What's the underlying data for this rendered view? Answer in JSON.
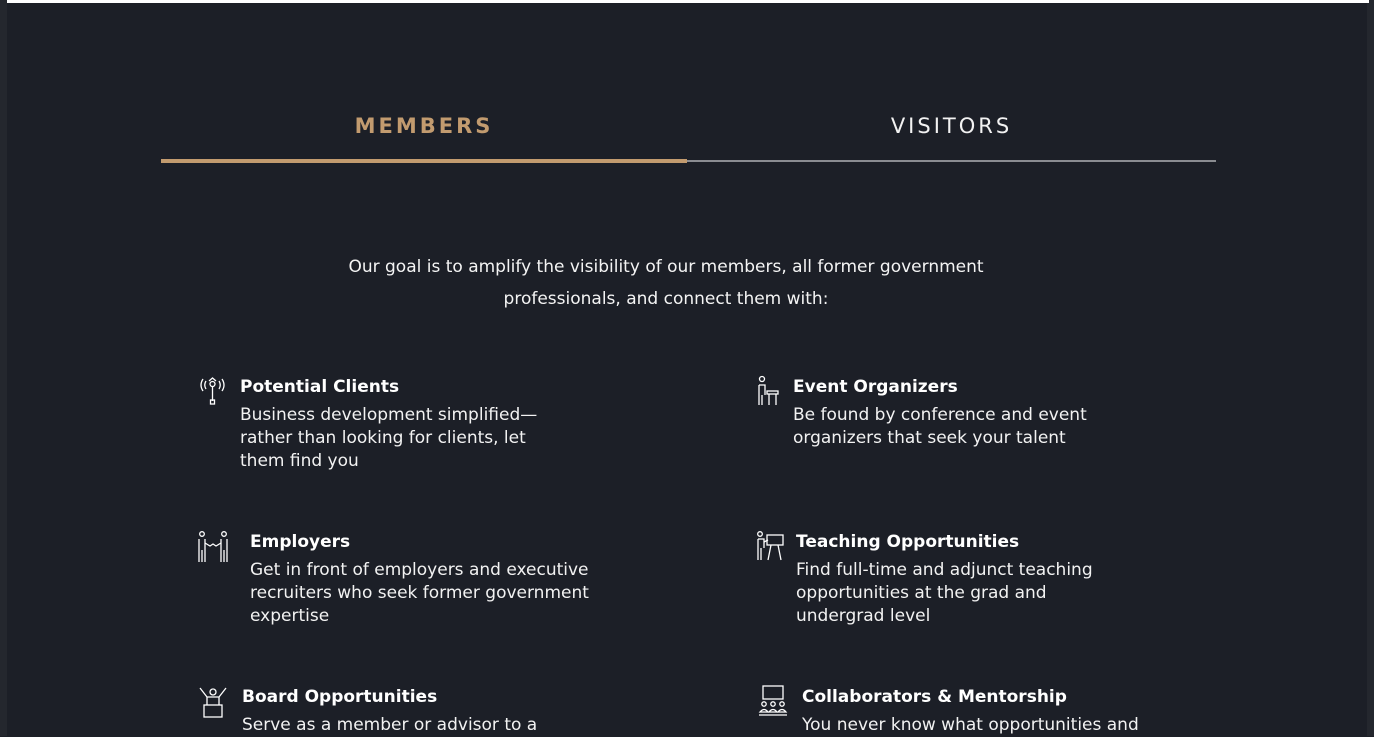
{
  "tabs": {
    "members": "MEMBERS",
    "visitors": "VISITORS"
  },
  "intro": {
    "line1": "Our goal is to amplify the visibility of our members, all former government",
    "line2": "professionals, and connect them with:"
  },
  "features": [
    {
      "icon": "broadcast-icon",
      "title": "Potential Clients",
      "desc": "Business development simplified—rather than looking for clients, let them find you"
    },
    {
      "icon": "speaker-podium-icon",
      "title": "Event Organizers",
      "desc": "Be found by conference and event organizers that seek your talent"
    },
    {
      "icon": "handshake-icon",
      "title": "Employers",
      "desc": "Get in front of employers and executive recruiters who seek former government expertise"
    },
    {
      "icon": "teacher-board-icon",
      "title": "Teaching Opportunities",
      "desc": "Find full-time and adjunct teaching opportunities at the grad and undergrad level"
    },
    {
      "icon": "podium-person-icon",
      "title": "Board Opportunities",
      "desc": "Serve as a member or advisor to a"
    },
    {
      "icon": "audience-screen-icon",
      "title": "Collaborators & Mentorship",
      "desc": "You never know what opportunities and"
    }
  ],
  "colors": {
    "background": "#1c1f27",
    "accent": "#c29b6f",
    "text": "#ffffff",
    "tab_line": "#8a8c91"
  }
}
